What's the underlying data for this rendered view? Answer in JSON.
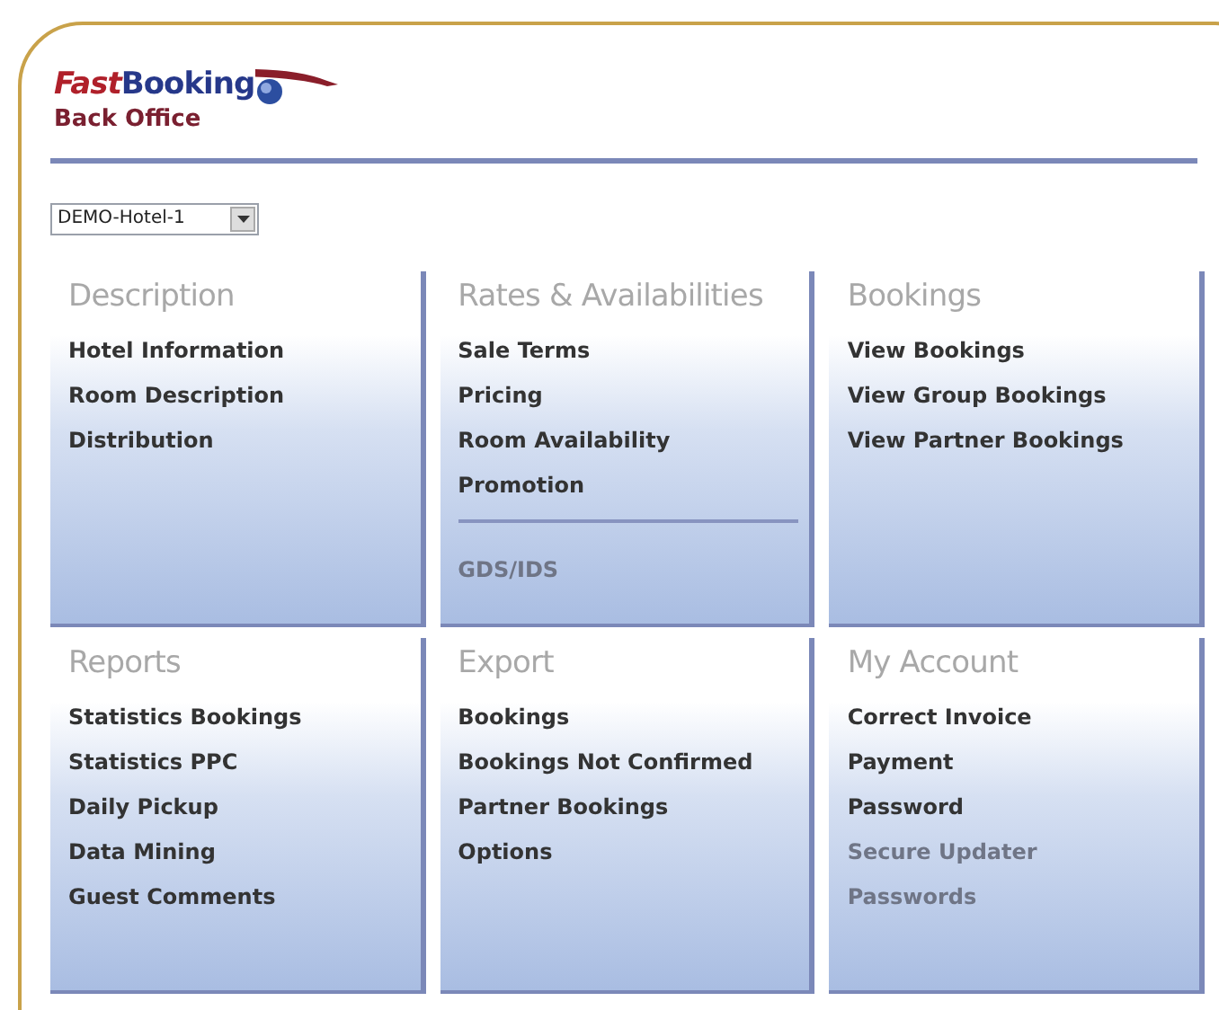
{
  "logo": {
    "brand_part1": "Fast",
    "brand_part2": "Booking",
    "subtitle": "Back Office"
  },
  "hotel_select": {
    "value": "DEMO-Hotel-1"
  },
  "panels": [
    {
      "title": "Description",
      "items": [
        {
          "label": "Hotel Information",
          "disabled": false,
          "separated": false
        },
        {
          "label": "Room Description",
          "disabled": false,
          "separated": false
        },
        {
          "label": "Distribution",
          "disabled": false,
          "separated": false
        }
      ]
    },
    {
      "title": "Rates & Availabilities",
      "items": [
        {
          "label": "Sale Terms",
          "disabled": false,
          "separated": false
        },
        {
          "label": "Pricing",
          "disabled": false,
          "separated": false
        },
        {
          "label": "Room Availability",
          "disabled": false,
          "separated": false
        },
        {
          "label": "Promotion",
          "disabled": false,
          "separated": false
        },
        {
          "label": "GDS/IDS",
          "disabled": true,
          "separated": true
        }
      ]
    },
    {
      "title": "Bookings",
      "items": [
        {
          "label": "View Bookings",
          "disabled": false,
          "separated": false
        },
        {
          "label": "View Group Bookings",
          "disabled": false,
          "separated": false
        },
        {
          "label": "View Partner Bookings",
          "disabled": false,
          "separated": false
        }
      ]
    },
    {
      "title": "Reports",
      "items": [
        {
          "label": "Statistics Bookings",
          "disabled": false,
          "separated": false
        },
        {
          "label": "Statistics PPC",
          "disabled": false,
          "separated": false
        },
        {
          "label": "Daily Pickup",
          "disabled": false,
          "separated": false
        },
        {
          "label": "Data Mining",
          "disabled": false,
          "separated": false
        },
        {
          "label": "Guest Comments",
          "disabled": false,
          "separated": false
        }
      ]
    },
    {
      "title": "Export",
      "items": [
        {
          "label": "Bookings",
          "disabled": false,
          "separated": false
        },
        {
          "label": "Bookings Not Confirmed",
          "disabled": false,
          "separated": false
        },
        {
          "label": "Partner Bookings",
          "disabled": false,
          "separated": false
        },
        {
          "label": "Options",
          "disabled": false,
          "separated": false
        }
      ]
    },
    {
      "title": "My Account",
      "items": [
        {
          "label": "Correct Invoice",
          "disabled": false,
          "separated": false
        },
        {
          "label": "Payment",
          "disabled": false,
          "separated": false
        },
        {
          "label": "Password",
          "disabled": false,
          "separated": false
        },
        {
          "label": "Secure Updater\nPasswords",
          "disabled": true,
          "separated": false
        }
      ]
    }
  ]
}
